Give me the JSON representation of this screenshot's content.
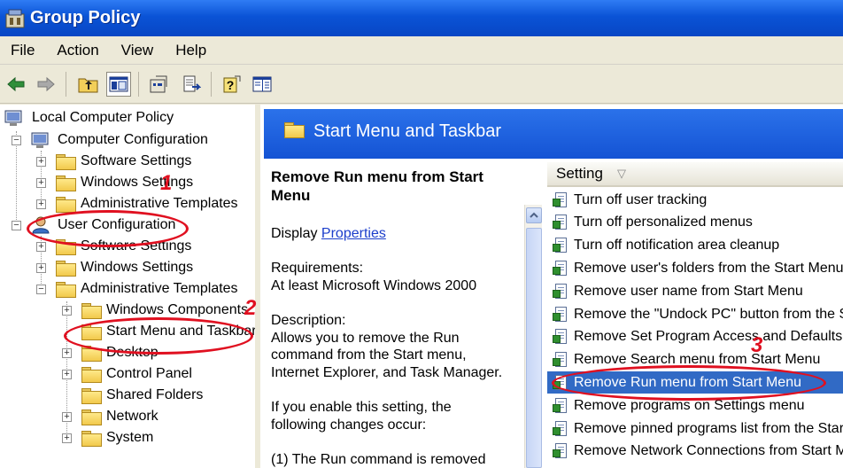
{
  "window": {
    "title": "Group Policy"
  },
  "menu": [
    "File",
    "Action",
    "View",
    "Help"
  ],
  "toolbar": {
    "icons": [
      "back-icon",
      "forward-icon",
      "up-folder-icon",
      "show-tree-icon",
      "properties-icon",
      "export-list-icon",
      "help-icon",
      "extended-view-icon"
    ]
  },
  "tree": {
    "root": "Local Computer Policy",
    "computer_config": "Computer Configuration",
    "cc_software": "Software Settings",
    "cc_windows": "Windows Settings",
    "cc_admin": "Administrative Templates",
    "user_config": "User Configuration",
    "uc_software": "Software Settings",
    "uc_windows": "Windows Settings",
    "uc_admin": "Administrative Templates",
    "windows_components": "Windows Components",
    "start_menu": "Start Menu and Taskbar",
    "desktop": "Desktop",
    "control_panel": "Control Panel",
    "shared_folders": "Shared Folders",
    "network": "Network",
    "system": "System"
  },
  "header": {
    "title": "Start Menu and Taskbar"
  },
  "description": {
    "title": "Remove Run menu from Start Menu",
    "display_label": "Display",
    "properties_link": "Properties",
    "requirements_label": "Requirements:",
    "requirements_value": "At least Microsoft Windows 2000",
    "description_label": "Description:",
    "desc_line1": "Allows you to remove the Run",
    "desc_line2": "command from the Start menu,",
    "desc_line3": "Internet Explorer, and Task Manager.",
    "desc_line4": "If you enable this setting, the",
    "desc_line5": "following changes occur:",
    "desc_line6": "(1) The Run command is removed"
  },
  "settings": {
    "column_header": "Setting",
    "items": [
      "Turn off user tracking",
      "Turn off personalized menus",
      "Turn off notification area cleanup",
      "Remove user's folders from the Start Menu",
      "Remove user name from Start Menu",
      "Remove the \"Undock PC\" button from the Start Menu",
      "Remove Set Program Access and Defaults from Start menu",
      "Remove Search menu from Start Menu",
      "Remove Run menu from Start Menu",
      "Remove programs on Settings menu",
      "Remove pinned programs list from the Start Menu",
      "Remove Network Connections from Start Menu"
    ],
    "selected_index": 8
  },
  "annotations": {
    "one": "1",
    "two": "2",
    "three": "3"
  },
  "colors": {
    "title_bar": "#0a53d6",
    "selection": "#316ac5",
    "annotation": "#e01020"
  }
}
